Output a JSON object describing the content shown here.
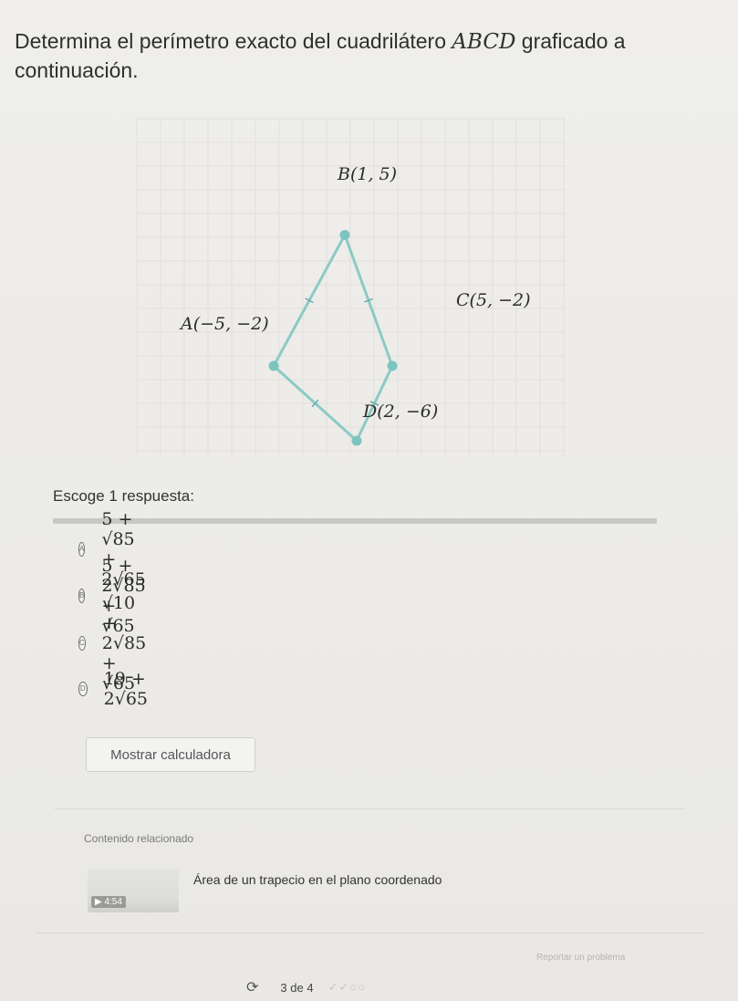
{
  "question": {
    "text_before": "Determina el perímetro exacto del cuadrilátero ",
    "shape_name": "ABCD",
    "text_after": " graficado a continuación."
  },
  "graph": {
    "points": [
      {
        "id": "A",
        "label": "A(−5, −2)",
        "x": -5,
        "y": -2
      },
      {
        "id": "B",
        "label": "B(1, 5)",
        "x": 1,
        "y": 5
      },
      {
        "id": "C",
        "label": "C(5, −2)",
        "x": 5,
        "y": -2
      },
      {
        "id": "D",
        "label": "D(2, −6)",
        "x": 2,
        "y": -6
      }
    ],
    "line_color": "#8ccac6",
    "point_color": "#7cc4bf"
  },
  "prompt": "Escoge 1 respuesta:",
  "options": [
    {
      "letter": "A",
      "text": "5 + √85 + 2√65"
    },
    {
      "letter": "B",
      "text": "5 + 2√85 + √65"
    },
    {
      "letter": "C",
      "text": "√10 + 2√85 + √65"
    },
    {
      "letter": "D",
      "text": "19 + 2√65"
    }
  ],
  "calculator_button": "Mostrar calculadora",
  "related": {
    "title": "Contenido relacionado",
    "video_badge": "▶ 4:54",
    "link": "Área de un trapecio en el plano coordenado"
  },
  "footer": {
    "report": "Reportar un problema",
    "progress": "3 de 4",
    "dots": "✓✓○○"
  }
}
